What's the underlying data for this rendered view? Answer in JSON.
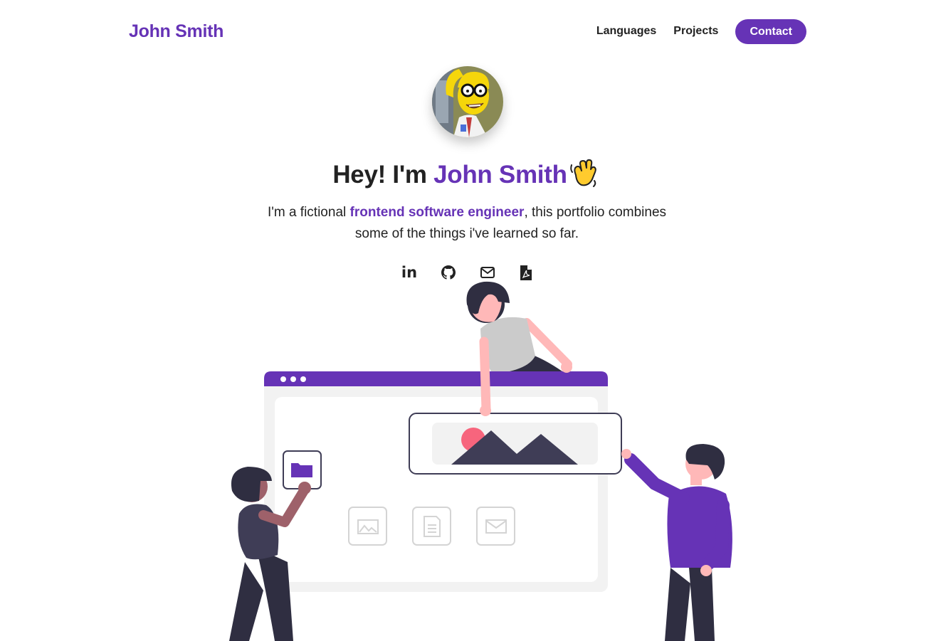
{
  "header": {
    "brand": "John Smith",
    "nav": [
      {
        "label": "Languages"
      },
      {
        "label": "Projects"
      }
    ],
    "contact_label": "Contact"
  },
  "hero": {
    "greeting": "Hey! I'm ",
    "name": "John Smith",
    "sub_pre": "I'm a fictional ",
    "sub_highlight": "frontend software engineer",
    "sub_post": ", this portfolio combines some of the things i've learned so far."
  },
  "socials": {
    "linkedin_text": "in",
    "icons": [
      "linkedin-icon",
      "github-icon",
      "mail-icon",
      "pdf-icon"
    ]
  },
  "colors": {
    "accent": "#6633b6",
    "text": "#222222",
    "dark": "#2f2e41",
    "skin": "#ffb8b8",
    "pink": "#f7657d"
  }
}
